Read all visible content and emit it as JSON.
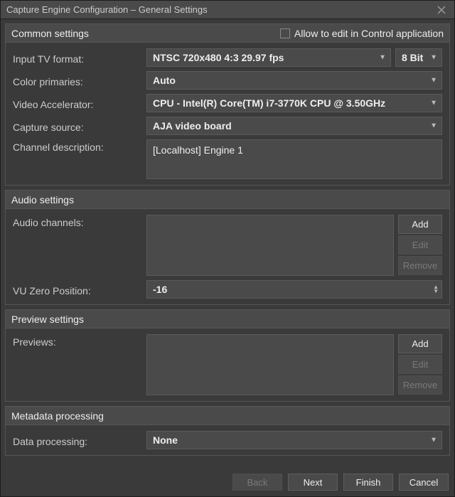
{
  "window": {
    "title": "Capture Engine Configuration – General Settings"
  },
  "common": {
    "header": "Common settings",
    "allow_edit_label": "Allow to edit in Control application",
    "allow_edit_checked": false,
    "input_tv_format_label": "Input TV format:",
    "input_tv_format_value": "NTSC 720x480 4:3 29.97 fps",
    "bit_depth_value": "8 Bit",
    "color_primaries_label": "Color primaries:",
    "color_primaries_value": "Auto",
    "video_accel_label": "Video Accelerator:",
    "video_accel_value": "CPU - Intel(R) Core(TM) i7-3770K CPU @ 3.50GHz",
    "capture_source_label": "Capture source:",
    "capture_source_value": "AJA video board",
    "channel_desc_label": "Channel description:",
    "channel_desc_value": "[Localhost] Engine 1"
  },
  "audio": {
    "header": "Audio settings",
    "audio_channels_label": "Audio channels:",
    "add_label": "Add",
    "edit_label": "Edit",
    "remove_label": "Remove",
    "vu_zero_label": "VU Zero Position:",
    "vu_zero_value": "-16"
  },
  "preview": {
    "header": "Preview settings",
    "previews_label": "Previews:",
    "add_label": "Add",
    "edit_label": "Edit",
    "remove_label": "Remove"
  },
  "metadata": {
    "header": "Metadata processing",
    "data_processing_label": "Data processing:",
    "data_processing_value": "None"
  },
  "footer": {
    "back": "Back",
    "next": "Next",
    "finish": "Finish",
    "cancel": "Cancel"
  }
}
